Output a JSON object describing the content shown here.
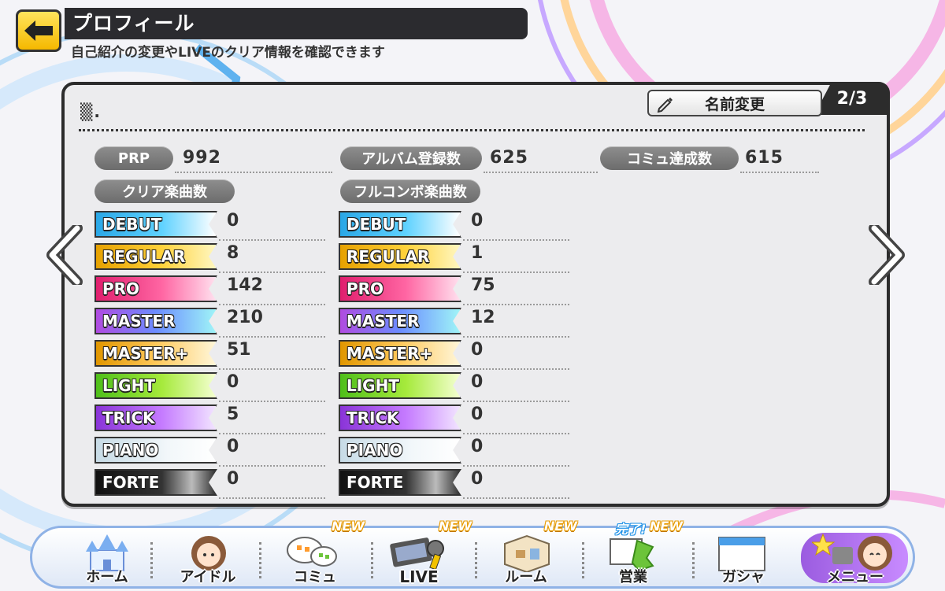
{
  "header": {
    "title": "プロフィール",
    "subtitle": "自己紹介の変更やLIVEのクリア情報を確認できます"
  },
  "panel": {
    "page_indicator": "2/3",
    "player_name": "▒.",
    "rename_button": "名前変更",
    "stats": {
      "prp_label": "PRP",
      "prp_value": "992",
      "album_label": "アルバム登録数",
      "album_value": "625",
      "commu_label": "コミュ達成数",
      "commu_value": "615"
    },
    "clear_header": "クリア楽曲数",
    "fullcombo_header": "フルコンボ楽曲数",
    "clear": [
      {
        "difficulty": "DEBUT",
        "count": "0"
      },
      {
        "difficulty": "REGULAR",
        "count": "8"
      },
      {
        "difficulty": "PRO",
        "count": "142"
      },
      {
        "difficulty": "MASTER",
        "count": "210"
      },
      {
        "difficulty": "MASTER+",
        "count": "51"
      },
      {
        "difficulty": "LIGHT",
        "count": "0"
      },
      {
        "difficulty": "TRICK",
        "count": "5"
      },
      {
        "difficulty": "PIANO",
        "count": "0"
      },
      {
        "difficulty": "FORTE",
        "count": "0"
      }
    ],
    "fullcombo": [
      {
        "difficulty": "DEBUT",
        "count": "0"
      },
      {
        "difficulty": "REGULAR",
        "count": "1"
      },
      {
        "difficulty": "PRO",
        "count": "75"
      },
      {
        "difficulty": "MASTER",
        "count": "12"
      },
      {
        "difficulty": "MASTER+",
        "count": "0"
      },
      {
        "difficulty": "LIGHT",
        "count": "0"
      },
      {
        "difficulty": "TRICK",
        "count": "0"
      },
      {
        "difficulty": "PIANO",
        "count": "0"
      },
      {
        "difficulty": "FORTE",
        "count": "0"
      }
    ]
  },
  "menu": {
    "items": [
      {
        "label": "ホーム",
        "badge": ""
      },
      {
        "label": "アイドル",
        "badge": ""
      },
      {
        "label": "コミュ",
        "badge": "NEW"
      },
      {
        "label": "LIVE",
        "badge": "NEW"
      },
      {
        "label": "ルーム",
        "badge": "NEW"
      },
      {
        "label": "営業",
        "badge": "NEW",
        "badge2": "完了!"
      },
      {
        "label": "ガシャ",
        "badge": ""
      },
      {
        "label": "メニュー",
        "badge": ""
      }
    ]
  },
  "colors": {
    "panel_border": "#2c2c2c",
    "back_button": "#f5b800",
    "menu_border": "#8fb2e6"
  }
}
